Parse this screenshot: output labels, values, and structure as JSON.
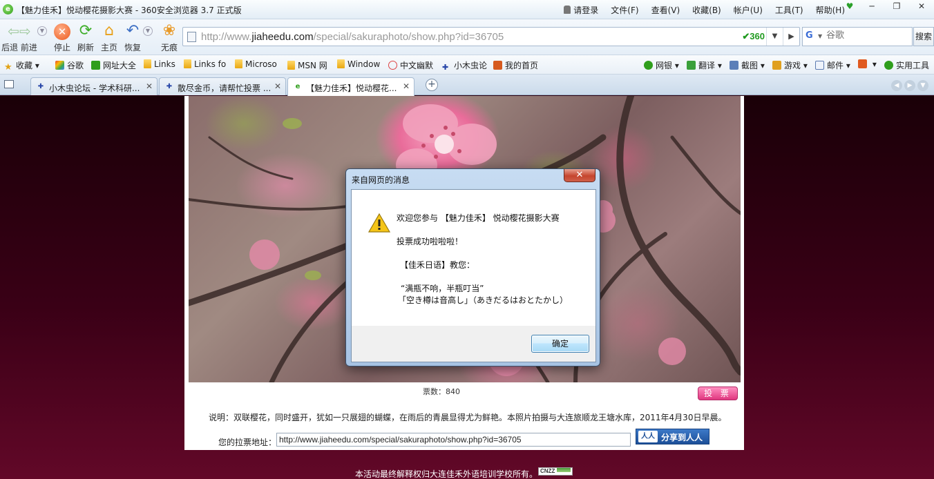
{
  "window": {
    "title": "【魅力佳禾】悦动樱花摄影大赛 - 360安全浏览器 3.7 正式版",
    "logo_glyph": "e"
  },
  "menu": [
    "请登录",
    "文件(F)",
    "查看(V)",
    "收藏(B)",
    "帐户(U)",
    "工具(T)",
    "帮助(H)"
  ],
  "nav": {
    "back_forward_label": "后退 前进",
    "stop_label": "停止",
    "refresh_label": "刷新",
    "home_label": "主页",
    "restore_label": "恢复",
    "incognito_label": "无痕"
  },
  "address": {
    "prefix": "http://www.",
    "domain": "jiaheedu.com",
    "path": "/special/sakuraphoto/show.php?id=36705",
    "badge": "360"
  },
  "search": {
    "engine_icon": "G",
    "placeholder": "谷歌",
    "button": "搜索"
  },
  "bookmarks": {
    "left": [
      "收藏",
      "谷歌",
      "网址大全",
      "Links",
      "Links fo",
      "Microso",
      "MSN 网",
      "Window",
      "中文幽默",
      "小木虫论",
      "我的首页"
    ],
    "right": [
      "网银",
      "翻译",
      "截图",
      "游戏",
      "邮件",
      "",
      "实用工具"
    ]
  },
  "tabs": [
    {
      "label": "小木虫论坛 - 学术科研...",
      "active": false
    },
    {
      "label": "散尽金币，请帮忙投票 ...",
      "active": false
    },
    {
      "label": "【魅力佳禾】悦动樱花...",
      "active": true
    }
  ],
  "content": {
    "votes": "票数：840",
    "vote_button": "投 票",
    "description": "说明：双联樱花，同时盛开，犹如一只展翅的蝴蝶，在雨后的青晨显得尤为鲜艳。本照片拍摄与大连旅顺龙王塘水库，2011年4月30日早晨。",
    "link_label": "您的拉票地址：",
    "link_url": "http://www.jiaheedu.com/special/sakuraphoto/show.php?id=36705",
    "share": "分享到人人",
    "share_logo": "人人",
    "footer": "本活动最终解释权归大连佳禾外语培训学校所有。",
    "cnzz": "CNZZ"
  },
  "dialog": {
    "title": "来自网页的消息",
    "lines": [
      "欢迎您参与 【魅力佳禾】 悦动樱花摄影大赛",
      "投票成功啦啦啦！",
      "【佳禾日语】教您：",
      "“满瓶不响，半瓶叮当”",
      "「空き樽は音高し」（あきだるはおとたかし）"
    ],
    "ok": "确定"
  }
}
